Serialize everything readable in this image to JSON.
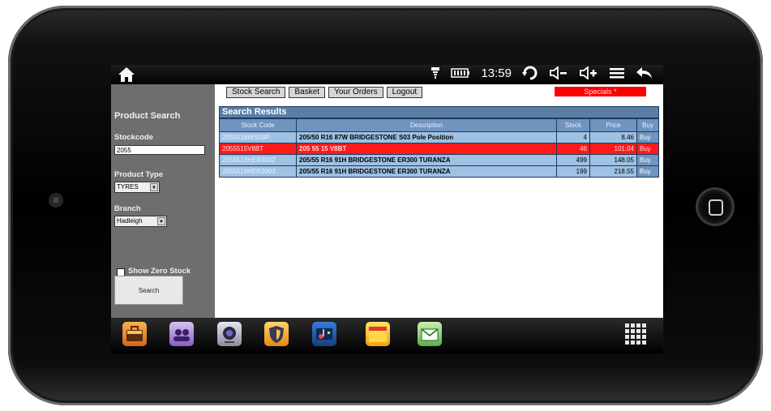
{
  "statusbar": {
    "time": "13:59"
  },
  "nav": {
    "tabs": [
      "Stock Search",
      "Basket",
      "Your Orders",
      "Logout"
    ],
    "specials": "Specials *"
  },
  "sidebar": {
    "title": "Product Search",
    "stockcode_label": "Stockcode",
    "stockcode_value": "2055",
    "product_type_label": "Product Type",
    "product_type_value": "TYRES",
    "branch_label": "Branch",
    "branch_value": "Hadleigh",
    "zero_stock_label": "Show Zero Stock",
    "search_button": "Search"
  },
  "results": {
    "title": "Search Results",
    "columns": [
      "Stock Code",
      "Description",
      "Stock",
      "Price",
      "Buy"
    ],
    "rows": [
      {
        "code": "2055016WS03P",
        "description": "205/50 R16 87W BRIDGESTONE S03 Pole Position",
        "stock": "4",
        "price": "8.46",
        "buy": "Buy",
        "highlight": false
      },
      {
        "code": "2055515V8BT",
        "description": "205 55 15 V8BT",
        "stock": "46",
        "price": "101.04",
        "buy": "Buy",
        "highlight": true
      },
      {
        "code": "2055516HER3002",
        "description": "205/55 R16 91H BRIDGESTONE ER300 TURANZA",
        "stock": "499",
        "price": "148.05",
        "buy": "Buy",
        "highlight": false
      },
      {
        "code": "2055516HER3003",
        "description": "205/55 R16 91H BRIDGESTONE ER300 TURANZA",
        "stock": "199",
        "price": "218.55",
        "buy": "Buy",
        "highlight": false
      }
    ]
  },
  "colors": {
    "results_header": "#5a7ea6",
    "row_blue": "#9fc1e3",
    "row_red": "#ff1a1a",
    "specials": "#ff0000",
    "sidebar": "#6e6e6e"
  },
  "dock": {
    "icons": [
      "briefcase-icon",
      "contacts-icon",
      "camera-icon",
      "security-shield-icon",
      "music-icon",
      "folder-icon",
      "email-icon",
      "app-grid-icon"
    ]
  }
}
